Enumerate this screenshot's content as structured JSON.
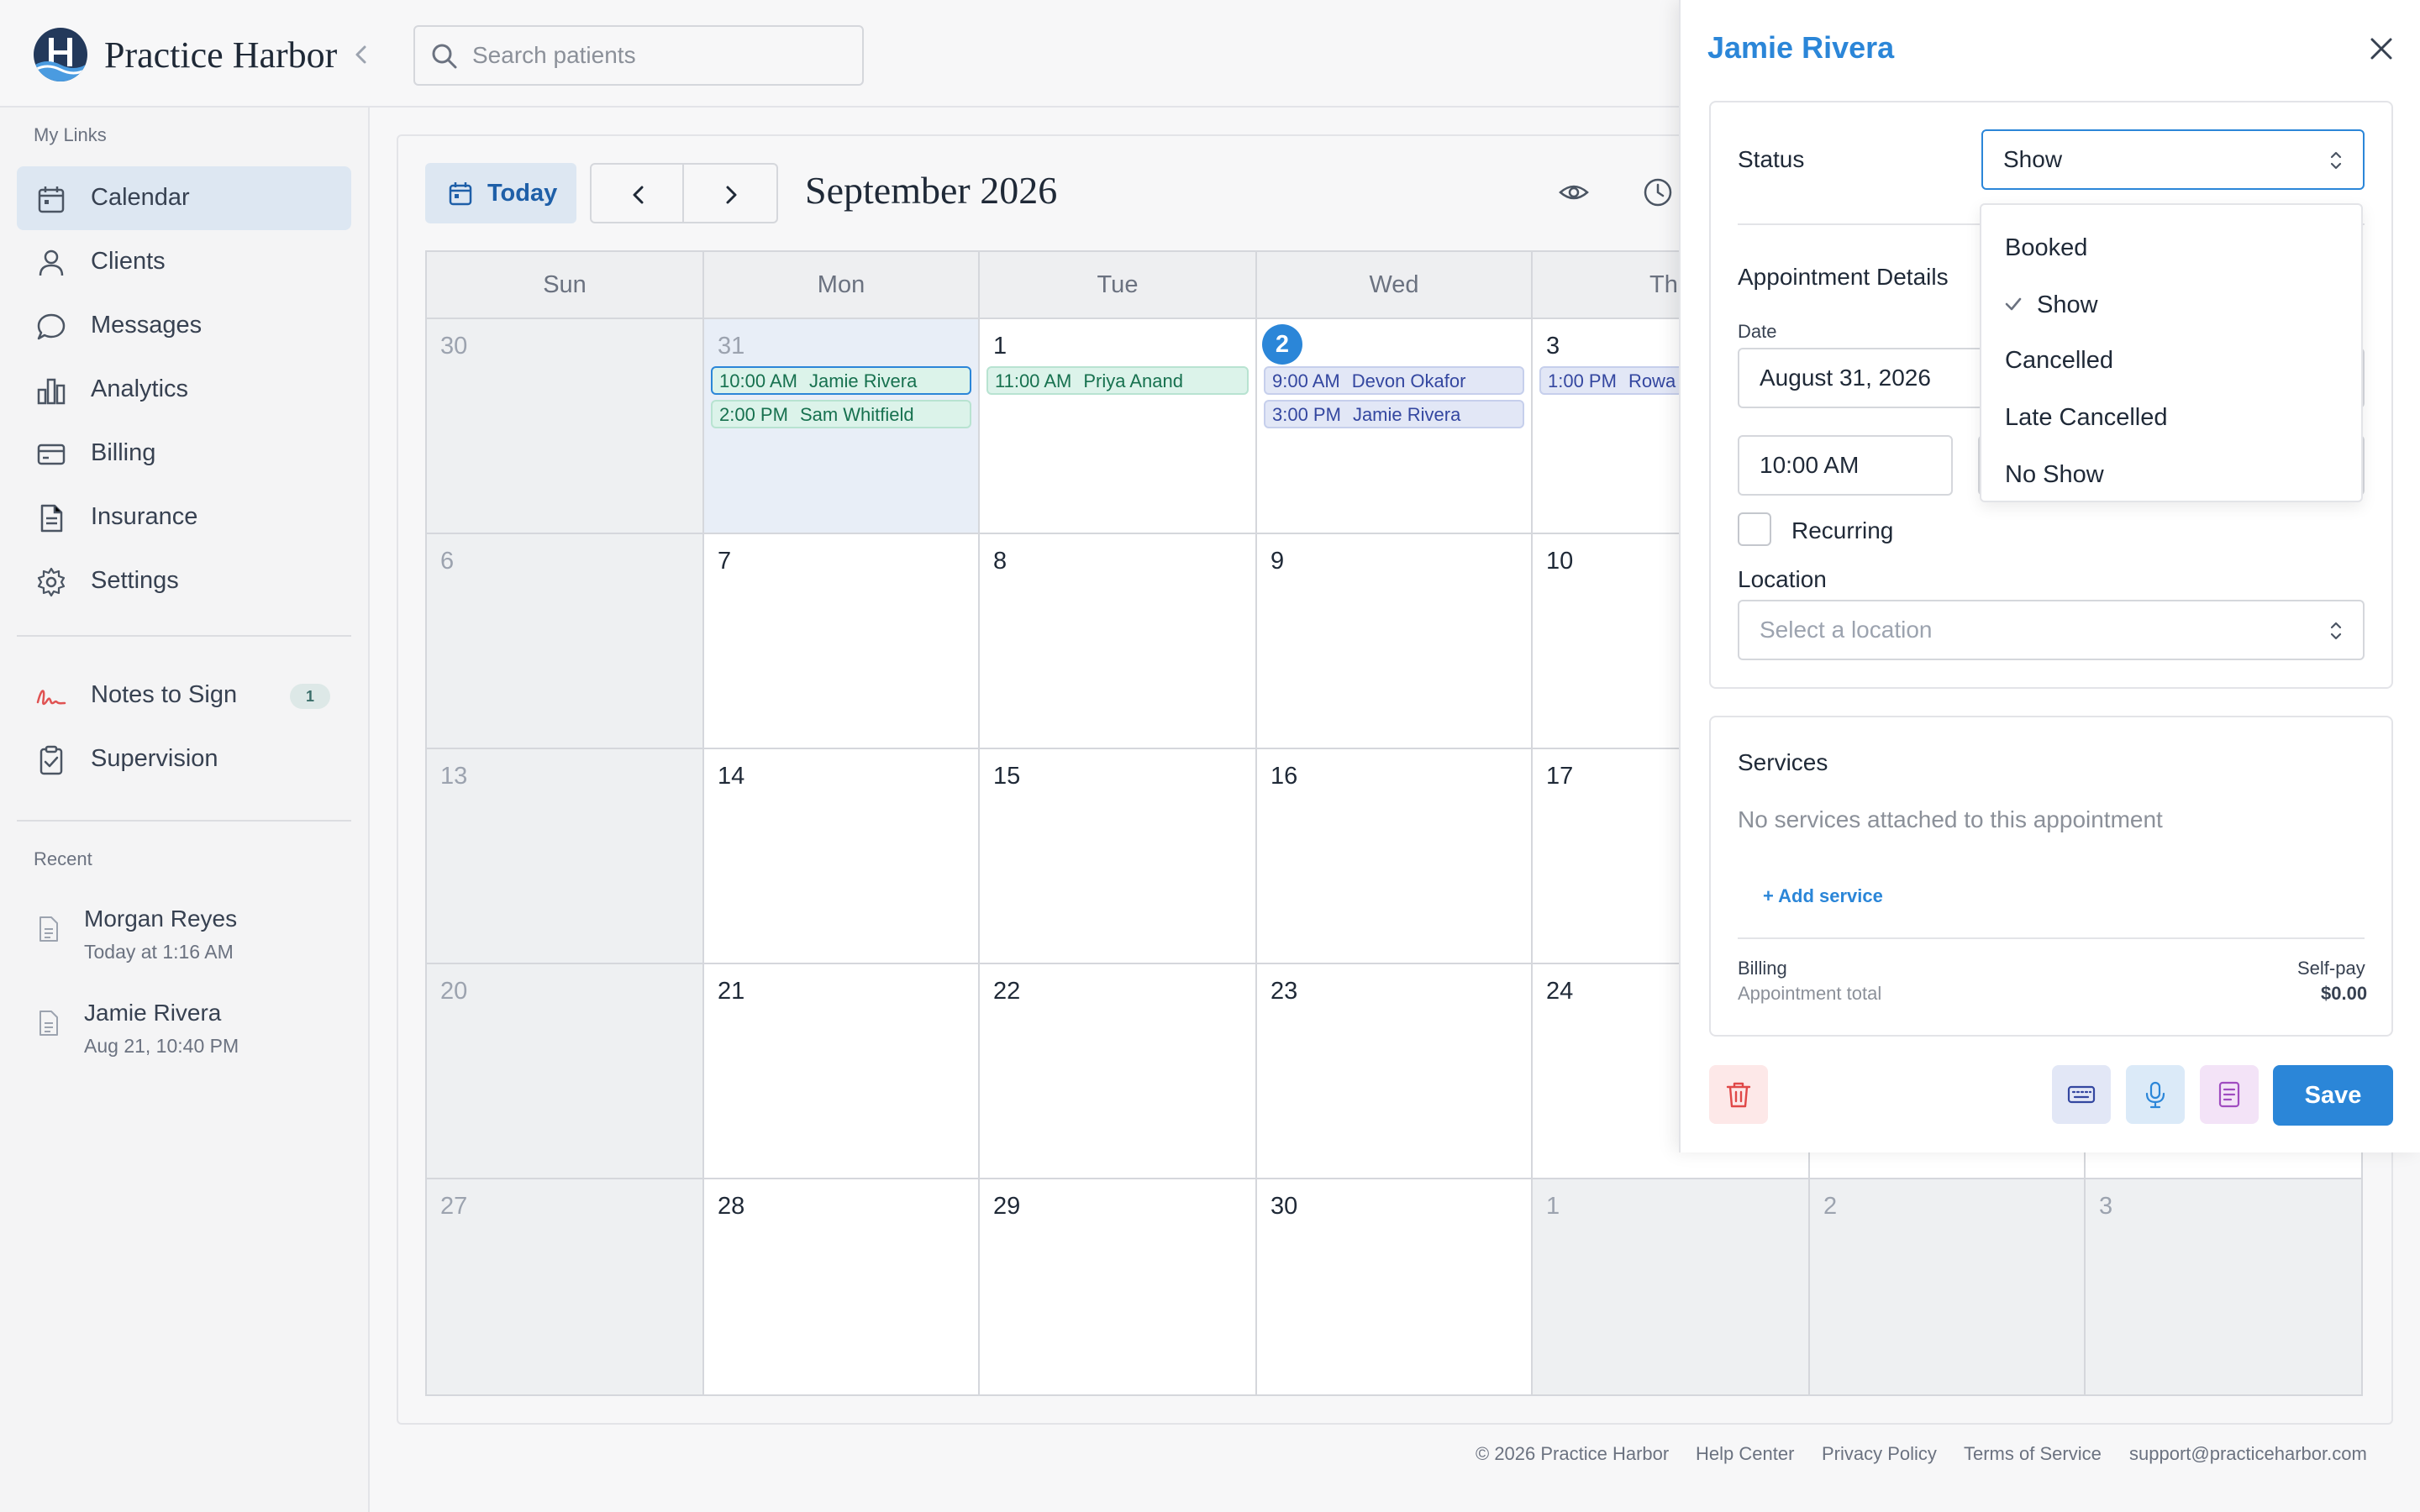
{
  "app": {
    "brand": "Practice Harbor"
  },
  "search": {
    "placeholder": "Search patients"
  },
  "sidebar": {
    "my_links_label": "My Links",
    "items": [
      {
        "label": "Calendar"
      },
      {
        "label": "Clients"
      },
      {
        "label": "Messages"
      },
      {
        "label": "Analytics"
      },
      {
        "label": "Billing"
      },
      {
        "label": "Insurance"
      },
      {
        "label": "Settings"
      }
    ],
    "notes": {
      "label": "Notes to Sign",
      "count": "1"
    },
    "supervision": {
      "label": "Supervision"
    },
    "recent_label": "Recent",
    "recent": [
      {
        "name": "Morgan Reyes",
        "time": "Today at 1:16 AM"
      },
      {
        "name": "Jamie Rivera",
        "time": "Aug 21, 10:40 PM"
      }
    ]
  },
  "calendar": {
    "today_label": "Today",
    "month": "September 2026",
    "days": [
      "Sun",
      "Mon",
      "Tue",
      "Wed",
      "Thu"
    ],
    "week1": [
      "30",
      "31",
      "1",
      "2",
      "3"
    ],
    "week2": [
      "6",
      "7",
      "8",
      "9",
      "10"
    ],
    "week3": [
      "13",
      "14",
      "15",
      "16",
      "17"
    ],
    "week4": [
      "20",
      "21",
      "22",
      "23",
      "24"
    ],
    "week5": [
      "27",
      "28",
      "29",
      "30",
      "1",
      "2",
      "3"
    ],
    "events": {
      "mon1": {
        "time": "10:00 AM",
        "name": "Jamie Rivera"
      },
      "mon2": {
        "time": "2:00 PM",
        "name": "Sam Whitfield"
      },
      "tue1": {
        "time": "11:00 AM",
        "name": "Priya Anand"
      },
      "wed1": {
        "time": "9:00 AM",
        "name": "Devon Okafor"
      },
      "wed2": {
        "time": "3:00 PM",
        "name": "Jamie Rivera"
      },
      "thu1": {
        "time": "1:00 PM",
        "name": "Rowa"
      }
    }
  },
  "footer": {
    "copyright": "© 2026 Practice Harbor",
    "help": "Help Center",
    "privacy": "Privacy Policy",
    "terms": "Terms of Service",
    "support": "support@practiceharbor.com"
  },
  "drawer": {
    "title": "Jamie Rivera",
    "status_label": "Status",
    "status_value": "Show",
    "status_options": [
      "Booked",
      "Show",
      "Cancelled",
      "Late Cancelled",
      "No Show"
    ],
    "details_label": "Appointment Details",
    "date_label": "Date",
    "date_value": "August 31, 2026",
    "time_value": "10:00 AM",
    "recurring_label": "Recurring",
    "location_label": "Location",
    "location_placeholder": "Select a location",
    "services_label": "Services",
    "services_empty": "No services attached to this appointment",
    "add_service": "+ Add service",
    "billing_label": "Billing",
    "billing_value": "Self-pay",
    "total_label": "Appointment total",
    "total_value": "$0.00",
    "save_label": "Save"
  },
  "colors": {
    "accent": "#2b86d8",
    "event_green": "#dcf3ea",
    "event_blue": "#e2e7f6",
    "delete": "#e04848"
  }
}
